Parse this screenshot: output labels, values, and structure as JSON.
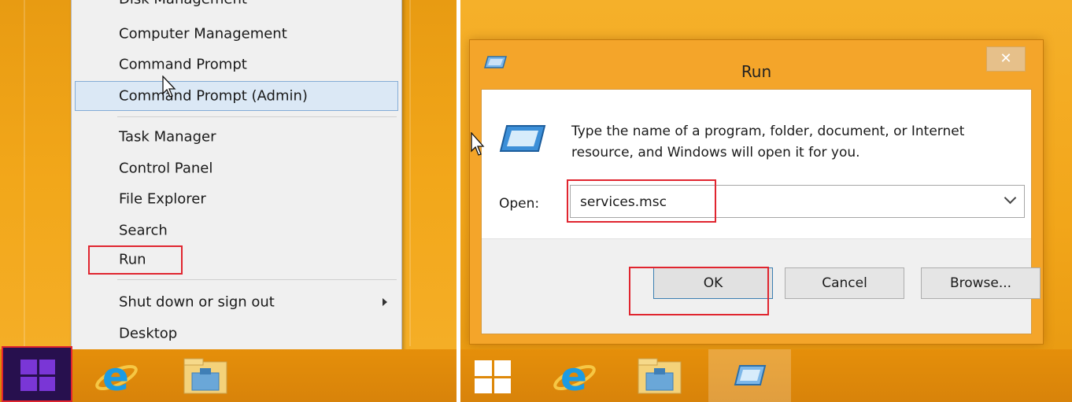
{
  "left": {
    "menu": {
      "items": [
        {
          "label": "Disk Management"
        },
        {
          "label": "Computer Management"
        },
        {
          "label": "Command Prompt"
        },
        {
          "label": "Command Prompt (Admin)"
        },
        {
          "label": "Task Manager"
        },
        {
          "label": "Control Panel"
        },
        {
          "label": "File Explorer"
        },
        {
          "label": "Search"
        },
        {
          "label": "Run"
        },
        {
          "label": "Shut down or sign out"
        },
        {
          "label": "Desktop"
        }
      ]
    },
    "taskbar": {
      "icons": [
        "windows-start-icon",
        "internet-explorer-icon",
        "file-explorer-icon"
      ]
    }
  },
  "right": {
    "run_dialog": {
      "title": "Run",
      "close_label": "✕",
      "description": "Type the name of a program, folder, document, or Internet resource, and Windows will open it for you.",
      "open_label": "Open:",
      "input_value": "services.msc",
      "buttons": {
        "ok": "OK",
        "cancel": "Cancel",
        "browse": "Browse..."
      }
    },
    "taskbar": {
      "icons": [
        "windows-start-icon",
        "internet-explorer-icon",
        "file-explorer-icon",
        "run-app-icon"
      ]
    }
  },
  "colors": {
    "highlight_box": "#e0252f",
    "menu_selection": "#dbe8f5",
    "desktop": "#f2a71a",
    "start_button": "#3a1a7a"
  }
}
